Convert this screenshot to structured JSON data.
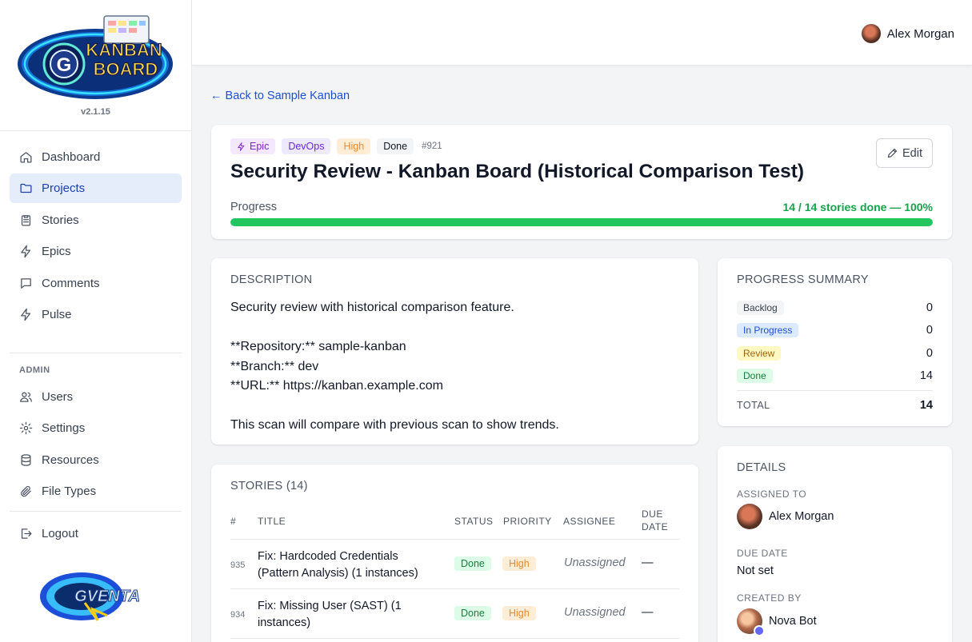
{
  "app": {
    "version": "v2.1.15",
    "logo_text": [
      "KANBAN",
      "BOARD"
    ],
    "footer_logo_text": "GVENTA"
  },
  "sidebar": {
    "items": [
      {
        "label": "Dashboard",
        "icon": "home-icon"
      },
      {
        "label": "Projects",
        "icon": "folder-icon",
        "active": true
      },
      {
        "label": "Stories",
        "icon": "clipboard-icon"
      },
      {
        "label": "Epics",
        "icon": "lightning-icon"
      },
      {
        "label": "Comments",
        "icon": "comment-icon"
      },
      {
        "label": "Pulse",
        "icon": "lightning-icon"
      }
    ],
    "admin_label": "ADMIN",
    "admin_items": [
      {
        "label": "Users",
        "icon": "users-icon"
      },
      {
        "label": "Settings",
        "icon": "gear-icon"
      },
      {
        "label": "Resources",
        "icon": "database-icon"
      },
      {
        "label": "File Types",
        "icon": "paperclip-icon"
      }
    ],
    "logout_label": "Logout"
  },
  "topbar": {
    "user_name": "Alex Morgan"
  },
  "back_link": "← Back to Sample Kanban",
  "epic": {
    "badges": {
      "type": "Epic",
      "category": "DevOps",
      "priority": "High",
      "status": "Done",
      "id": "#921"
    },
    "title": "Security Review - Kanban Board (Historical Comparison Test)",
    "edit_label": "Edit",
    "progress_label": "Progress",
    "progress_text": "14 / 14 stories done — 100%",
    "progress_fraction": 1.0
  },
  "description": {
    "heading": "DESCRIPTION",
    "lines": [
      "Security review with historical comparison feature.",
      "",
      "**Repository:** sample-kanban",
      "**Branch:** dev",
      "**URL:** https://kanban.example.com",
      "",
      "This scan will compare with previous scan to show trends."
    ]
  },
  "summary": {
    "heading": "PROGRESS SUMMARY",
    "rows": [
      {
        "label": "Backlog",
        "value": "0",
        "color_bg": "#f3f4f6",
        "color_fg": "#374151"
      },
      {
        "label": "In Progress",
        "value": "0",
        "color_bg": "#dbeafe",
        "color_fg": "#1d4ed8"
      },
      {
        "label": "Review",
        "value": "0",
        "color_bg": "#fef9c3",
        "color_fg": "#a16207"
      },
      {
        "label": "Done",
        "value": "14",
        "color_bg": "#dcfce7",
        "color_fg": "#15803d"
      }
    ],
    "total_label": "TOTAL",
    "total_value": "14"
  },
  "details": {
    "heading": "DETAILS",
    "assigned_label": "ASSIGNED TO",
    "assigned_name": "Alex Morgan",
    "due_label": "DUE DATE",
    "due_value": "Not set",
    "created_label": "CREATED BY",
    "created_name": "Nova Bot"
  },
  "stories": {
    "heading": "STORIES (14)",
    "columns": [
      "#",
      "TITLE",
      "STATUS",
      "PRIORITY",
      "ASSIGNEE",
      "DUE",
      "DATE"
    ],
    "rows": [
      {
        "id": "935",
        "title": "Fix: Hardcoded Credentials (Pattern Analysis) (1 instances)",
        "status": "Done",
        "priority": "High",
        "assignee": "Unassigned",
        "due": "—"
      },
      {
        "id": "934",
        "title": "Fix: Missing User (SAST) (1 instances)",
        "status": "Done",
        "priority": "High",
        "assignee": "Unassigned",
        "due": "—"
      }
    ]
  },
  "colors": {
    "accent": "#1d4ed8",
    "progress": "#22c55e",
    "active_nav_bg": "#e5edfa"
  }
}
